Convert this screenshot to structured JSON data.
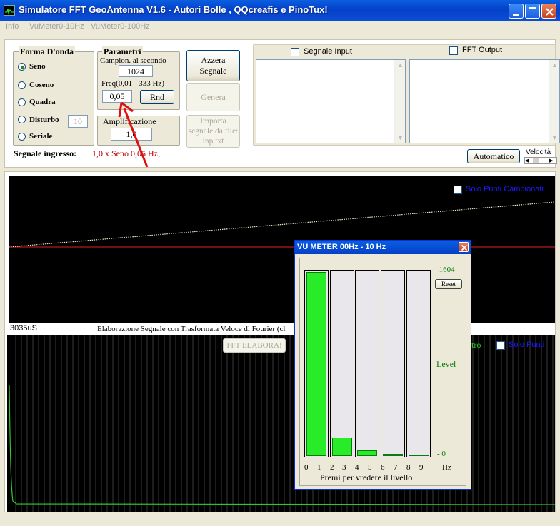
{
  "window": {
    "title": "Simulatore FFT GeoAntenna V1.6 - Autori Bolle , QQcreafis e PinoTux!"
  },
  "menu": [
    "Info",
    "VuMeter0-10Hz",
    "VuMeter0-100Hz"
  ],
  "forma_onda": {
    "title": "Forma D'onda",
    "options": [
      "Seno",
      "Coseno",
      "Quadra",
      "Disturbo",
      "Seriale"
    ],
    "selected": "Seno",
    "disturbo_value": "10"
  },
  "parametri": {
    "title": "Parametri",
    "campion_label": "Campion. al secondo",
    "campion_value": "1024",
    "freq_label": "Freq(0,01 - 333  Hz)",
    "freq_value": "0,05",
    "rnd_label": "Rnd"
  },
  "amplificazione": {
    "label": "Amplificazione",
    "value": "1,0"
  },
  "buttons": {
    "azzera": "Azzera Segnale",
    "genera": "Genera",
    "importa": "Importa segnale da file: inp.txt",
    "automatico": "Automatico",
    "velocita": "Velocità",
    "fft_elabora": "FFT ELABORA!"
  },
  "signal": {
    "label": "Segnale ingresso:",
    "value": "1,0 x Seno 0,05 Hz;"
  },
  "checks": {
    "segnale_input": "Segnale Input",
    "fft_output": "FFT Output",
    "solo_punti_campionati": "Solo Punti Campionati",
    "solo_punti": "Solo Punti"
  },
  "status": {
    "time": "3035uS",
    "text": "Elaborazione Segnale con Trasformata Veloce di Fourier (cl",
    "tro": "tro"
  },
  "colors": {
    "accent_red": "#c00000",
    "graph_bg": "#000000",
    "bar_green": "#28ec28",
    "title_blue": "#0a4fd8"
  },
  "vu_meter": {
    "title": "VU METER 00Hz - 10 Hz",
    "top_value": "-1604",
    "reset_label": "Reset",
    "level_label": "Level",
    "bottom_value": "- 0",
    "axis_ticks": [
      "0",
      "1",
      "2",
      "3",
      "4",
      "5",
      "6",
      "7",
      "8",
      "9"
    ],
    "axis_unit": "Hz",
    "hint": "Premi per vredere il livello",
    "bar_levels": [
      1.0,
      0.1,
      0.03,
      0.012,
      0.008
    ]
  }
}
